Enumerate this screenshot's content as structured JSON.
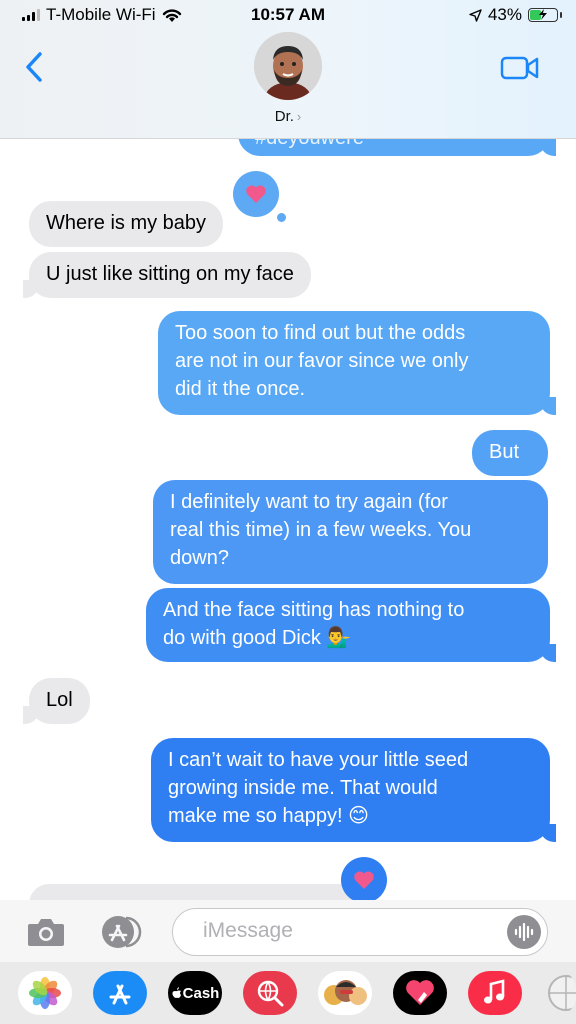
{
  "status_bar": {
    "carrier": "T-Mobile Wi-Fi",
    "time": "10:57 AM",
    "battery": "43%",
    "battery_level": 0.43
  },
  "header": {
    "contact_name": "Dr.",
    "chevron": "›"
  },
  "messages": {
    "partial_top": "#deyouwere",
    "m1": "Where is my baby",
    "m2": "U just like sitting on my face",
    "m3": [
      "Too soon to find out but the odds",
      "are not in our favor since we only",
      "did it the once."
    ],
    "m4": "But",
    "m5": [
      "I definitely want to try again (for",
      "real this time) in a few weeks. You",
      "down?"
    ],
    "m6": [
      "And the face sitting has nothing to",
      "do with good Dick 💁‍♂️"
    ],
    "m7": "Lol",
    "m8": [
      "I can’t wait to have your little seed",
      "growing inside me. That would",
      "make me so happy! 😊"
    ]
  },
  "input": {
    "placeholder": "iMessage"
  },
  "app_tray": {
    "cash_label": "Cash",
    "items": [
      "photos-app",
      "app-store",
      "apple-cash",
      "images-search",
      "memoji-stickers",
      "digital-touch",
      "music-app",
      "more-apps"
    ]
  },
  "colors": {
    "received_bubble": "#e9e9eb",
    "sent_top": "#58a8f6",
    "sent_bottom": "#2f7ff3",
    "tapback_heart": "#f1588c",
    "ios_blue": "#1a86f8"
  }
}
